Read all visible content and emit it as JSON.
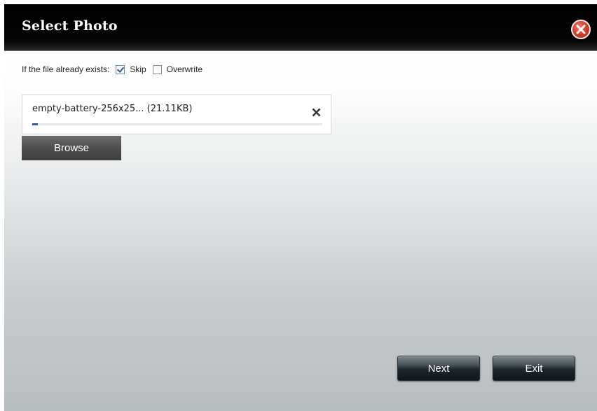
{
  "dialog": {
    "title": "Select Photo"
  },
  "options": {
    "prompt": "If the file already exists:",
    "skip_label": "Skip",
    "skip_checked": true,
    "overwrite_label": "Overwrite",
    "overwrite_checked": false
  },
  "file": {
    "name": "empty-battery-256x25... (21.11KB)",
    "progress_percent": 0.5
  },
  "buttons": {
    "browse": "Browse",
    "next": "Next",
    "exit": "Exit"
  },
  "icons": {
    "close": "close-icon",
    "remove": "remove-file-icon"
  }
}
